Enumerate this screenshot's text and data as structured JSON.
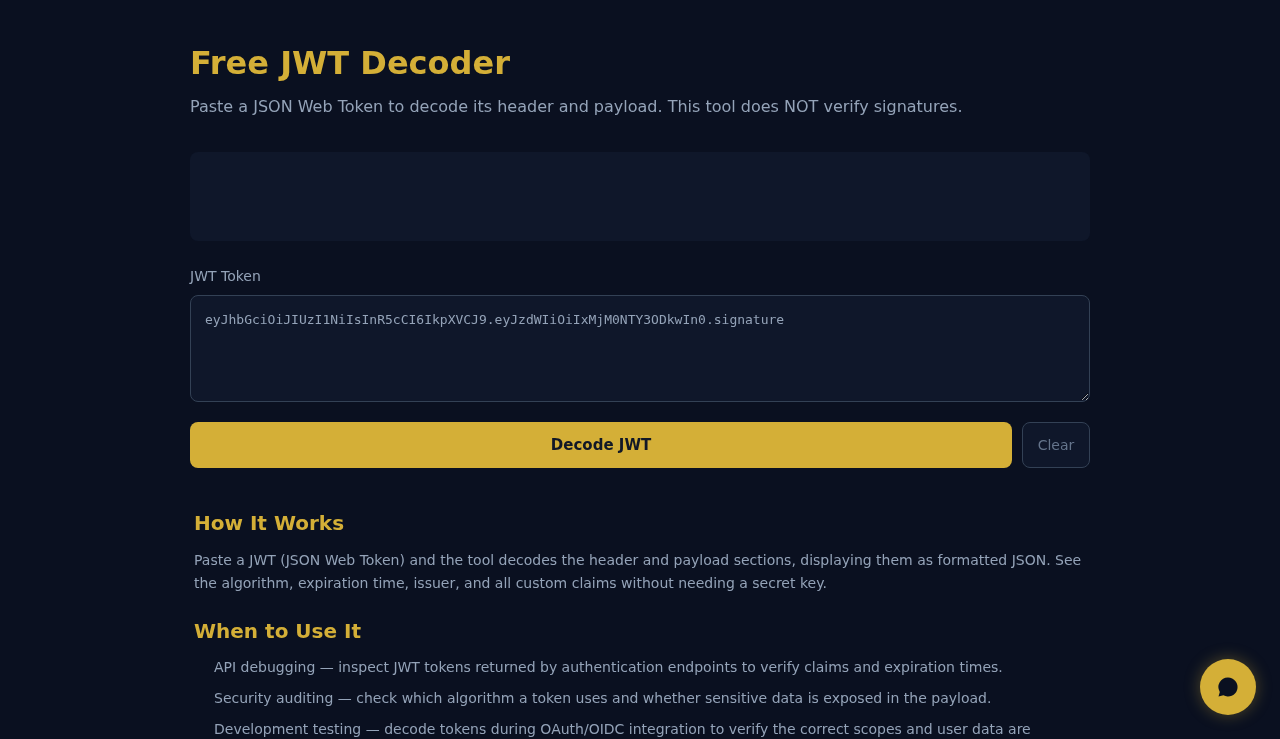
{
  "header": {
    "title": "Free JWT Decoder",
    "subtitle": "Paste a JSON Web Token to decode its header and payload. This tool does NOT verify signatures."
  },
  "token_input": {
    "label": "JWT Token",
    "value": "eyJhbGciOiJIUzI1NiIsInR5cCI6IkpXVCJ9.eyJzdWIiOiIxMjM0NTY3ODkwIn0.signature"
  },
  "buttons": [
    {
      "label": "Decode JWT",
      "kind": "primary"
    },
    {
      "label": "Clear",
      "kind": "secondary"
    }
  ],
  "sections": [
    {
      "kind": "paragraph",
      "heading": "How It Works",
      "text": "Paste a JWT (JSON Web Token) and the tool decodes the header and payload sections, displaying them as formatted JSON. See the algorithm, expiration time, issuer, and all custom claims without needing a secret key."
    },
    {
      "kind": "list",
      "heading": "When to Use It",
      "items": [
        "API debugging — inspect JWT tokens returned by authentication endpoints to verify claims and expiration times.",
        "Security auditing — check which algorithm a token uses and whether sensitive data is exposed in the payload.",
        "Development testing — decode tokens during OAuth/OIDC integration to verify the correct scopes and user data are"
      ]
    }
  ]
}
